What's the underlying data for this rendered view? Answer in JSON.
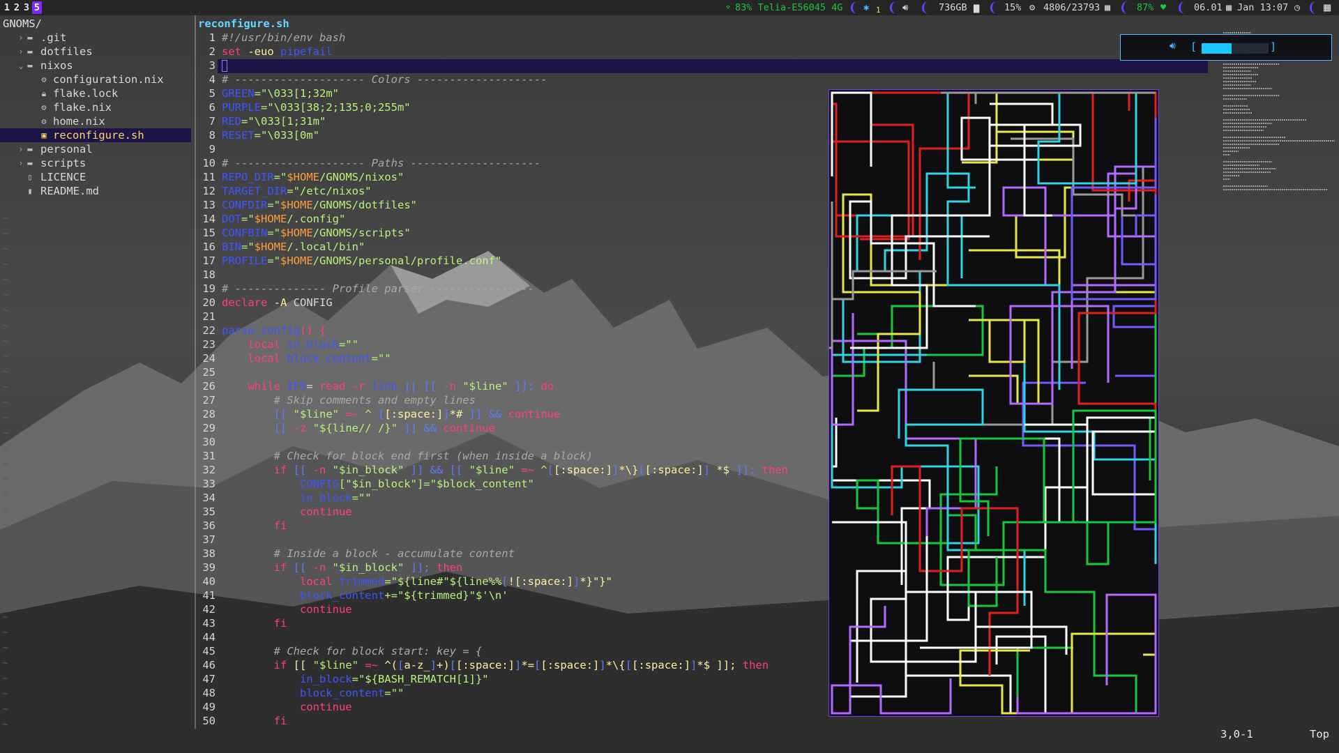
{
  "topbar": {
    "workspaces": [
      "1",
      "2",
      "3",
      "5"
    ],
    "active_workspace": "5",
    "wifi": "83% Telia-E56045 4G",
    "bluetooth": "1",
    "disk": "736GB",
    "cpu": "15%",
    "memory": "4806/23793",
    "battery": "87%",
    "date": "06.01",
    "datetime": "Jan 13:07",
    "accent_color": "#6a3fff"
  },
  "tree": {
    "root": "GNOMS/",
    "items": [
      {
        "chev": "›",
        "icon": "folder-icon",
        "name": ".git",
        "depth": 1
      },
      {
        "chev": "›",
        "icon": "folder-icon",
        "name": "dotfiles",
        "depth": 1
      },
      {
        "chev": "⌄",
        "icon": "folder-open-icon",
        "name": "nixos",
        "depth": 1
      },
      {
        "chev": "",
        "icon": "gear-file-icon",
        "name": "configuration.nix",
        "depth": 2
      },
      {
        "chev": "",
        "icon": "lock-icon",
        "name": "flake.lock",
        "depth": 2
      },
      {
        "chev": "",
        "icon": "gear-file-icon",
        "name": "flake.nix",
        "depth": 2
      },
      {
        "chev": "",
        "icon": "gear-file-icon",
        "name": "home.nix",
        "depth": 2
      },
      {
        "chev": "",
        "icon": "shell-file-icon",
        "name": "reconfigure.sh",
        "depth": 2,
        "selected": true
      },
      {
        "chev": "›",
        "icon": "folder-icon",
        "name": "personal",
        "depth": 1
      },
      {
        "chev": "›",
        "icon": "folder-icon",
        "name": "scripts",
        "depth": 1
      },
      {
        "chev": "",
        "icon": "file-icon",
        "name": "LICENCE",
        "depth": 1
      },
      {
        "chev": "",
        "icon": "book-icon",
        "name": "README.md",
        "depth": 1
      }
    ]
  },
  "editor": {
    "filename": "reconfigure.sh",
    "lines": [
      [
        [
          "#!/usr/bin/env bash",
          "c"
        ]
      ],
      [
        [
          "set ",
          "k"
        ],
        [
          "-euo ",
          "y"
        ],
        [
          "pipefail",
          "v"
        ]
      ],
      [],
      [
        [
          "# -------------------- Colors --------------------",
          "c"
        ]
      ],
      [
        [
          "GREEN",
          "v"
        ],
        [
          "=\"\\033[1;32m\"",
          "s"
        ]
      ],
      [
        [
          "PURPLE",
          "v"
        ],
        [
          "=\"\\033[38;2;135;0;255m\"",
          "s"
        ]
      ],
      [
        [
          "RED",
          "v"
        ],
        [
          "=\"\\033[1;31m\"",
          "s"
        ]
      ],
      [
        [
          "RESET",
          "v"
        ],
        [
          "=\"\\033[0m\"",
          "s"
        ]
      ],
      [],
      [
        [
          "# -------------------- Paths --------------------",
          "c"
        ]
      ],
      [
        [
          "REPO_DIR",
          "v"
        ],
        [
          "=\"",
          "s"
        ],
        [
          "$HOME",
          "o"
        ],
        [
          "/GNOMS/nixos\"",
          "s"
        ]
      ],
      [
        [
          "TARGET_DIR",
          "v"
        ],
        [
          "=\"/etc/nixos\"",
          "s"
        ]
      ],
      [
        [
          "CONFDIR",
          "v"
        ],
        [
          "=\"",
          "s"
        ],
        [
          "$HOME",
          "o"
        ],
        [
          "/GNOMS/dotfiles\"",
          "s"
        ]
      ],
      [
        [
          "DOT",
          "v"
        ],
        [
          "=\"",
          "s"
        ],
        [
          "$HOME",
          "o"
        ],
        [
          "/.config\"",
          "s"
        ]
      ],
      [
        [
          "CONFBIN",
          "v"
        ],
        [
          "=\"",
          "s"
        ],
        [
          "$HOME",
          "o"
        ],
        [
          "/GNOMS/scripts\"",
          "s"
        ]
      ],
      [
        [
          "BIN",
          "v"
        ],
        [
          "=\"",
          "s"
        ],
        [
          "$HOME",
          "o"
        ],
        [
          "/.local/bin\"",
          "s"
        ]
      ],
      [
        [
          "PROFILE",
          "v"
        ],
        [
          "=\"",
          "s"
        ],
        [
          "$HOME",
          "o"
        ],
        [
          "/GNOMS/personal/profile.conf\"",
          "s"
        ]
      ],
      [],
      [
        [
          "# -------------- Profile parser ----------------",
          "c"
        ]
      ],
      [
        [
          "declare ",
          "k"
        ],
        [
          "-A ",
          "y"
        ],
        [
          "CONFIG",
          "p"
        ]
      ],
      [],
      [
        [
          "parse_config",
          "v"
        ],
        [
          "() {",
          "k"
        ]
      ],
      [
        [
          "    local ",
          "k"
        ],
        [
          "in_block",
          "v"
        ],
        [
          "=\"\"",
          "s"
        ]
      ],
      [
        [
          "    local ",
          "k"
        ],
        [
          "block_content",
          "v"
        ],
        [
          "=\"\"",
          "s"
        ]
      ],
      [],
      [
        [
          "    while ",
          "k"
        ],
        [
          "IFS",
          "v"
        ],
        [
          "= ",
          "p"
        ],
        [
          "read ",
          "k"
        ],
        [
          "-r ",
          "k"
        ],
        [
          "line ",
          "v"
        ],
        [
          "|| ",
          "b"
        ],
        [
          "[[ ",
          "b"
        ],
        [
          "-n ",
          "k"
        ],
        [
          "\"$line\"",
          "s"
        ],
        [
          " ]]; ",
          "b"
        ],
        [
          "do",
          "k"
        ]
      ],
      [
        [
          "        # Skip comments and empty lines",
          "c"
        ]
      ],
      [
        [
          "        [[ ",
          "b"
        ],
        [
          "\"$line\"",
          "s"
        ],
        [
          " =~ ",
          "k"
        ],
        [
          "^ ",
          "s"
        ],
        [
          "[",
          "b"
        ],
        [
          "[:space:]",
          "y"
        ],
        [
          "]",
          "b"
        ],
        [
          "*#",
          "y"
        ],
        [
          " ]] ",
          "b"
        ],
        [
          "&& ",
          "b"
        ],
        [
          "continue",
          "k"
        ]
      ],
      [
        [
          "        [[ ",
          "b"
        ],
        [
          "-z ",
          "k"
        ],
        [
          "\"${line// /}\"",
          "s"
        ],
        [
          " ]] ",
          "b"
        ],
        [
          "&& ",
          "b"
        ],
        [
          "continue",
          "k"
        ]
      ],
      [],
      [
        [
          "        # Check for block end first (when inside a block)",
          "c"
        ]
      ],
      [
        [
          "        if ",
          "k"
        ],
        [
          "[[ ",
          "b"
        ],
        [
          "-n ",
          "k"
        ],
        [
          "\"$in_block\"",
          "s"
        ],
        [
          " ]] ",
          "b"
        ],
        [
          "&& ",
          "b"
        ],
        [
          "[[ ",
          "b"
        ],
        [
          "\"$line\"",
          "s"
        ],
        [
          " =~ ",
          "k"
        ],
        [
          "^",
          "s"
        ],
        [
          "[",
          "b"
        ],
        [
          "[:space:]",
          "y"
        ],
        [
          "]",
          "b"
        ],
        [
          "*\\}",
          "y"
        ],
        [
          "[",
          "b"
        ],
        [
          "[:space:]",
          "y"
        ],
        [
          "]",
          "b"
        ],
        [
          " *$",
          "y"
        ],
        [
          " ]]; ",
          "b"
        ],
        [
          "then",
          "k"
        ]
      ],
      [
        [
          "            CONFIG",
          "v"
        ],
        [
          "[\"$in_block\"]=\"$block_content\"",
          "s"
        ]
      ],
      [
        [
          "            in_block",
          "v"
        ],
        [
          "=\"\"",
          "s"
        ]
      ],
      [
        [
          "            continue",
          "k"
        ]
      ],
      [
        [
          "        fi",
          "k"
        ]
      ],
      [],
      [
        [
          "        # Inside a block - accumulate content",
          "c"
        ]
      ],
      [
        [
          "        if ",
          "k"
        ],
        [
          "[[ ",
          "b"
        ],
        [
          "-n ",
          "k"
        ],
        [
          "\"$in_block\"",
          "s"
        ],
        [
          " ]]; ",
          "b"
        ],
        [
          "then",
          "k"
        ]
      ],
      [
        [
          "            local ",
          "k"
        ],
        [
          "trimmed",
          "v"
        ],
        [
          "=\"${line#\"${line%%",
          "s"
        ],
        [
          "[",
          "b"
        ],
        [
          "![:space:]",
          "y"
        ],
        [
          "]",
          "b"
        ],
        [
          "*}\"}\"",
          "y"
        ]
      ],
      [
        [
          "            block_content",
          "v"
        ],
        [
          "+=\"${trimmed}\"$'\\n'",
          "s"
        ]
      ],
      [
        [
          "            continue",
          "k"
        ]
      ],
      [
        [
          "        fi",
          "k"
        ]
      ],
      [],
      [
        [
          "        # Check for block start: key = {",
          "c"
        ]
      ],
      [
        [
          "        if ",
          "k"
        ],
        [
          "[[ ",
          "y"
        ],
        [
          "\"$line\"",
          "s"
        ],
        [
          " =~ ",
          "k"
        ],
        [
          "^(",
          "y"
        ],
        [
          "[",
          "b"
        ],
        [
          "a-z_",
          "y"
        ],
        [
          "]",
          "b"
        ],
        [
          "+)",
          "y"
        ],
        [
          "[",
          "b"
        ],
        [
          "[:space:]",
          "y"
        ],
        [
          "]",
          "b"
        ],
        [
          "*=",
          "y"
        ],
        [
          "[",
          "b"
        ],
        [
          "[:space:]",
          "y"
        ],
        [
          "]",
          "b"
        ],
        [
          "*\\{",
          "y"
        ],
        [
          "[",
          "b"
        ],
        [
          "[:space:]",
          "y"
        ],
        [
          "]",
          "b"
        ],
        [
          "*$",
          "y"
        ],
        [
          " ]]; ",
          "y"
        ],
        [
          "then",
          "k"
        ]
      ],
      [
        [
          "            in_block",
          "v"
        ],
        [
          "=\"${BASH_REMATCH[1]}\"",
          "s"
        ]
      ],
      [
        [
          "            block_content",
          "v"
        ],
        [
          "=\"\"",
          "s"
        ]
      ],
      [
        [
          "            continue",
          "k"
        ]
      ],
      [
        [
          "        fi",
          "k"
        ]
      ]
    ]
  },
  "osd": {
    "icon": "volume-icon",
    "level": 0.45
  },
  "status": {
    "position": "3,0-1",
    "scroll": "Top"
  },
  "pipes": {
    "colors": [
      "#2fd4e0",
      "#6f5cff",
      "#b46cff",
      "#e8e84a",
      "#19c83a",
      "#e02020",
      "#ffffff",
      "#9a9a9a"
    ]
  }
}
